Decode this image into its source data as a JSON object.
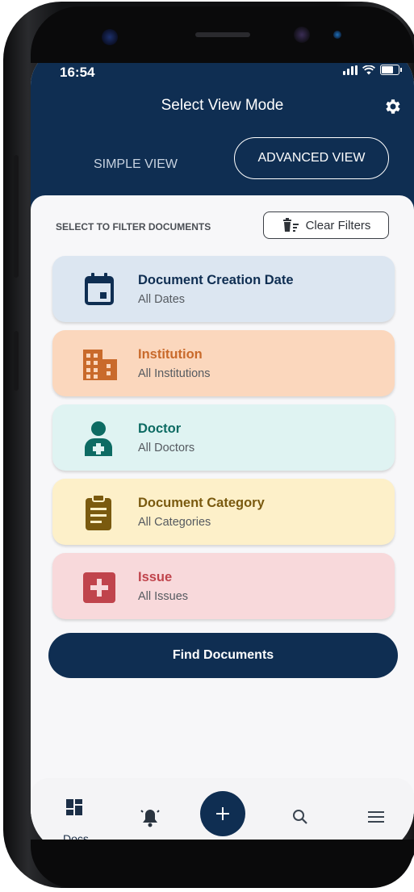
{
  "status_bar": {
    "time": "16:54"
  },
  "header": {
    "title": "Select View Mode"
  },
  "view_toggle": {
    "simple_label": "SIMPLE VIEW",
    "advanced_label": "ADVANCED VIEW",
    "selected": "ADVANCED VIEW"
  },
  "filters": {
    "label": "SELECT TO FILTER DOCUMENTS",
    "clear_label": "Clear Filters",
    "cards": [
      {
        "title": "Document Creation Date",
        "subtitle": "All Dates",
        "icon": "calendar-icon",
        "bg": "#dce6f1",
        "fg": "#0f2e52"
      },
      {
        "title": "Institution",
        "subtitle": "All Institutions",
        "icon": "building-icon",
        "bg": "#fbd7bd",
        "fg": "#c96a2b"
      },
      {
        "title": "Doctor",
        "subtitle": "All Doctors",
        "icon": "doctor-icon",
        "bg": "#dff3f2",
        "fg": "#0d6b63"
      },
      {
        "title": "Document Category",
        "subtitle": "All Categories",
        "icon": "clipboard-icon",
        "bg": "#fdf0c9",
        "fg": "#7a5a0f"
      },
      {
        "title": "Issue",
        "subtitle": "All Issues",
        "icon": "medical-cross-icon",
        "bg": "#f8d9db",
        "fg": "#c0444c"
      }
    ]
  },
  "find_button": {
    "label": "Find Documents"
  },
  "bottom_nav": {
    "docs_label": "Docs",
    "items": [
      "dashboard-icon",
      "bell-icon",
      "plus-icon",
      "search-icon",
      "menu-icon"
    ]
  },
  "colors": {
    "primary": "#0f2e52",
    "background": "#f7f7f9"
  }
}
